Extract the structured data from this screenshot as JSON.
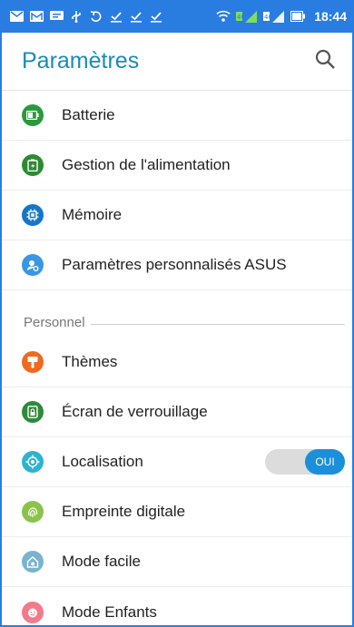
{
  "status_bar": {
    "time": "18:44",
    "notification_icons": [
      "mail-icon",
      "gmail-icon",
      "message-icon",
      "usb-icon",
      "sync-icon",
      "download-done-icon",
      "download-done-icon",
      "download-done-icon"
    ],
    "signal_label_1": "4G",
    "signal_label_2": "4G"
  },
  "app_bar": {
    "title": "Paramètres",
    "search_icon": "search-icon"
  },
  "items_top": [
    {
      "label": "Batterie",
      "icon": "battery-icon",
      "color": "#2b9a3d"
    },
    {
      "label": "Gestion de l'alimentation",
      "icon": "power-management-icon",
      "color": "#2d8a34"
    },
    {
      "label": "Mémoire",
      "icon": "memory-icon",
      "color": "#1576c8"
    },
    {
      "label": "Paramètres personnalisés ASUS",
      "icon": "asus-settings-icon",
      "color": "#3a97e0"
    }
  ],
  "section_personal": {
    "label": "Personnel"
  },
  "items_personal": [
    {
      "label": "Thèmes",
      "icon": "themes-icon",
      "color": "#ef6a1f"
    },
    {
      "label": "Écran de verrouillage",
      "icon": "lock-screen-icon",
      "color": "#2f8a3b"
    },
    {
      "label": "Localisation",
      "icon": "location-icon",
      "color": "#2eb3cf"
    },
    {
      "label": "Empreinte digitale",
      "icon": "fingerprint-icon",
      "color": "#8bc34a"
    },
    {
      "label": "Mode facile",
      "icon": "easy-mode-icon",
      "color": "#7ab3cf"
    },
    {
      "label": "Mode Enfants",
      "icon": "kids-mode-icon",
      "color": "#f27a8a"
    }
  ],
  "location_toggle": {
    "state_label": "OUI",
    "on": true
  },
  "colors": {
    "status_bar": "#2a7de0",
    "title": "#1a8bb8",
    "toggle_on": "#1c8fd9"
  }
}
